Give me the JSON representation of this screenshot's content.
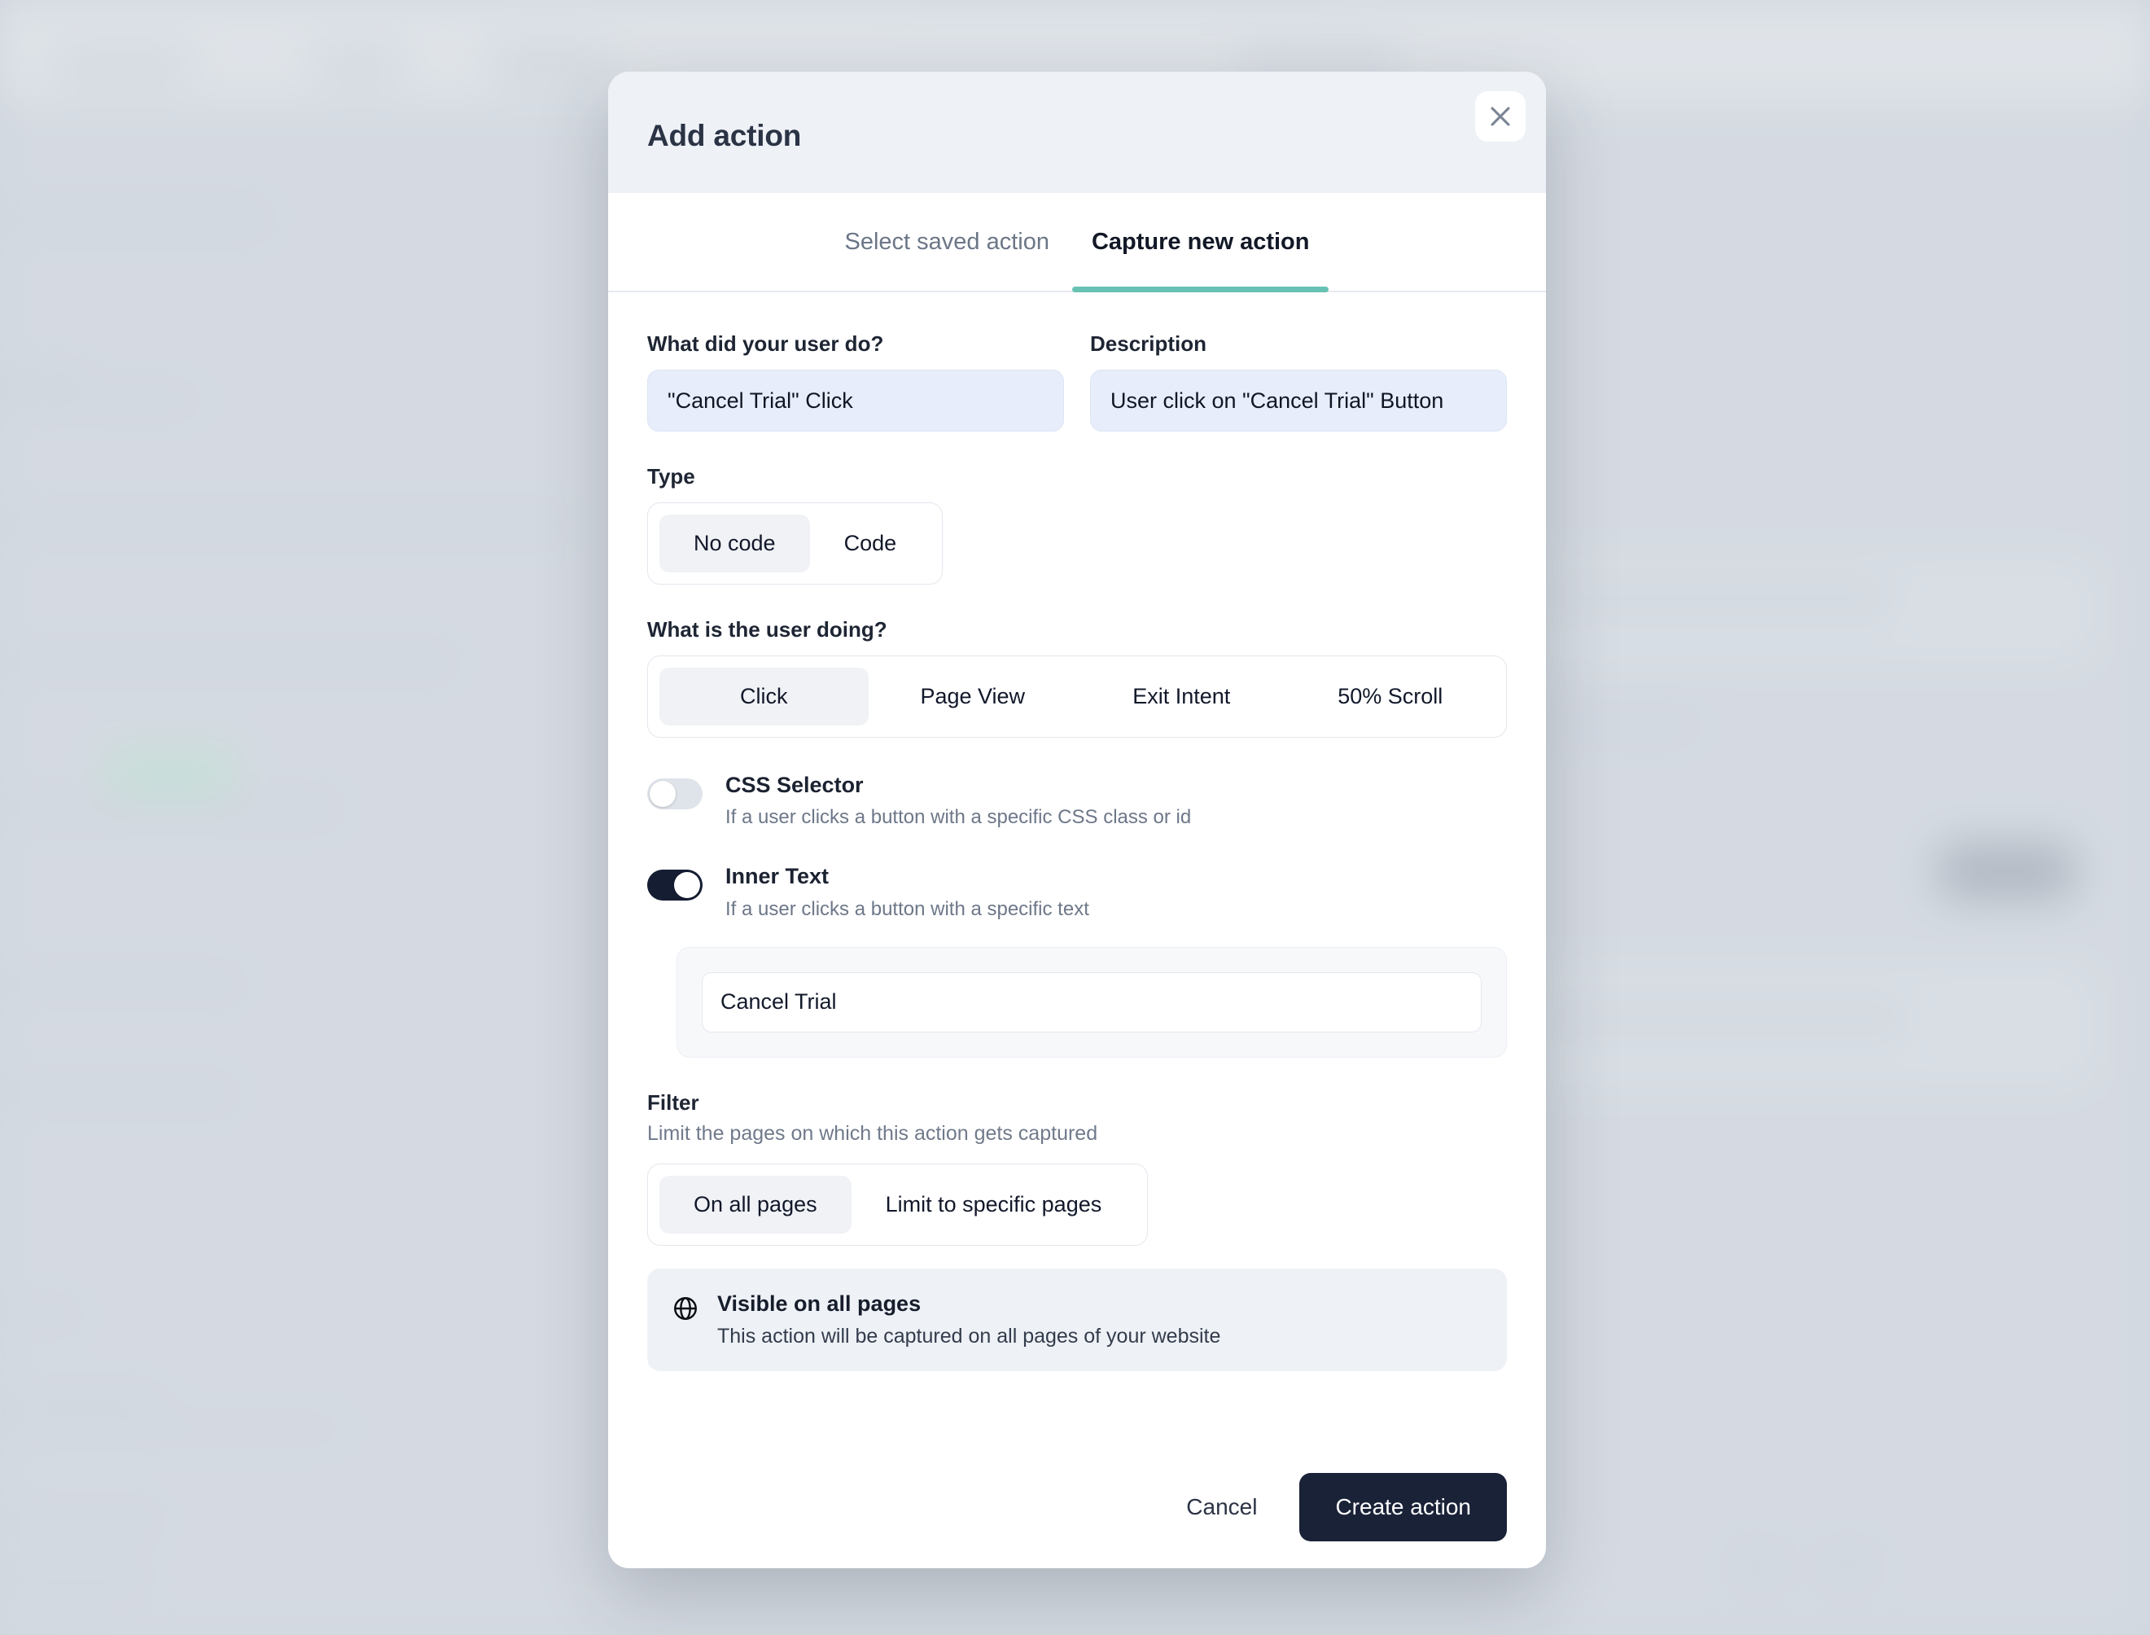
{
  "modal": {
    "title": "Add action",
    "close_icon": "close-icon",
    "tabs": [
      {
        "label": "Select saved action",
        "active": false
      },
      {
        "label": "Capture new action",
        "active": true
      }
    ],
    "accent_color": "#67c2b4",
    "form": {
      "name_field": {
        "label": "What did your user do?",
        "value": "\"Cancel Trial\" Click",
        "placeholder": "What did your user do?"
      },
      "description_field": {
        "label": "Description",
        "value": "User click on \"Cancel Trial\" Button",
        "placeholder": "Description"
      },
      "type": {
        "label": "Type",
        "options": [
          "No code",
          "Code"
        ],
        "selected": "No code"
      },
      "activity": {
        "label": "What is the user doing?",
        "options": [
          "Click",
          "Page View",
          "Exit Intent",
          "50% Scroll"
        ],
        "selected": "Click"
      },
      "css_selector_toggle": {
        "title": "CSS Selector",
        "description": "If a user clicks a button with a specific CSS class or id",
        "enabled": false
      },
      "inner_text_toggle": {
        "title": "Inner Text",
        "description": "If a user clicks a button with a specific text",
        "enabled": true,
        "value": "Cancel Trial",
        "placeholder": "Inner Text"
      },
      "filter": {
        "title": "Filter",
        "description": "Limit the pages on which this action gets captured",
        "options": [
          "On all pages",
          "Limit to specific pages"
        ],
        "selected": "On all pages"
      },
      "info": {
        "icon": "globe-icon",
        "title": "Visible on all pages",
        "description": "This action will be captured on all pages of your website"
      }
    },
    "footer": {
      "cancel_label": "Cancel",
      "create_label": "Create action"
    }
  }
}
